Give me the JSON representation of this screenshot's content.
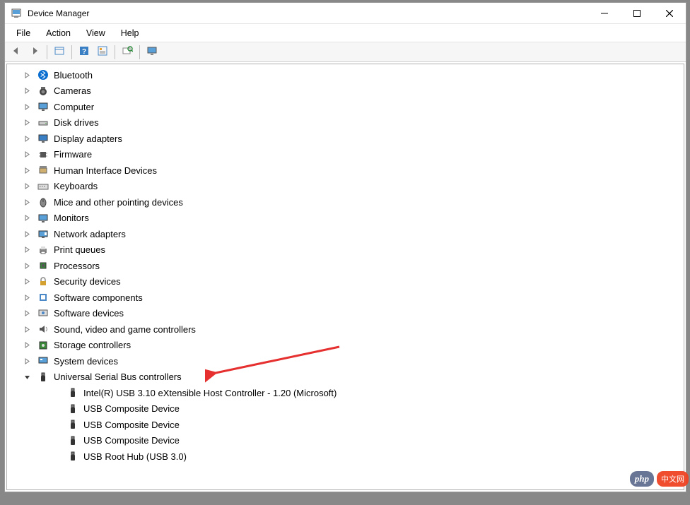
{
  "window": {
    "title": "Device Manager"
  },
  "menubar": {
    "items": [
      "File",
      "Action",
      "View",
      "Help"
    ]
  },
  "toolbar": {
    "buttons": [
      {
        "name": "back-icon"
      },
      {
        "name": "forward-icon"
      },
      {
        "sep": true
      },
      {
        "name": "show-hidden-icon"
      },
      {
        "sep": true
      },
      {
        "name": "help-icon"
      },
      {
        "name": "properties-icon"
      },
      {
        "sep": true
      },
      {
        "name": "scan-hardware-icon"
      },
      {
        "sep": true
      },
      {
        "name": "monitor-icon"
      }
    ]
  },
  "tree": {
    "categories": [
      {
        "label": "Bluetooth",
        "icon": "bluetooth",
        "expanded": false
      },
      {
        "label": "Cameras",
        "icon": "camera",
        "expanded": false
      },
      {
        "label": "Computer",
        "icon": "monitor",
        "expanded": false
      },
      {
        "label": "Disk drives",
        "icon": "disk",
        "expanded": false
      },
      {
        "label": "Display adapters",
        "icon": "display",
        "expanded": false
      },
      {
        "label": "Firmware",
        "icon": "chip",
        "expanded": false
      },
      {
        "label": "Human Interface Devices",
        "icon": "hid",
        "expanded": false
      },
      {
        "label": "Keyboards",
        "icon": "keyboard",
        "expanded": false
      },
      {
        "label": "Mice and other pointing devices",
        "icon": "mouse",
        "expanded": false
      },
      {
        "label": "Monitors",
        "icon": "monitor",
        "expanded": false
      },
      {
        "label": "Network adapters",
        "icon": "network",
        "expanded": false
      },
      {
        "label": "Print queues",
        "icon": "printer",
        "expanded": false
      },
      {
        "label": "Processors",
        "icon": "cpu",
        "expanded": false
      },
      {
        "label": "Security devices",
        "icon": "lock",
        "expanded": false
      },
      {
        "label": "Software components",
        "icon": "component",
        "expanded": false
      },
      {
        "label": "Software devices",
        "icon": "software",
        "expanded": false
      },
      {
        "label": "Sound, video and game controllers",
        "icon": "sound",
        "expanded": false
      },
      {
        "label": "Storage controllers",
        "icon": "storage",
        "expanded": false
      },
      {
        "label": "System devices",
        "icon": "system",
        "expanded": false
      },
      {
        "label": "Universal Serial Bus controllers",
        "icon": "usb",
        "expanded": true,
        "children": [
          {
            "label": "Intel(R) USB 3.10 eXtensible Host Controller - 1.20 (Microsoft)",
            "icon": "usb"
          },
          {
            "label": "USB Composite Device",
            "icon": "usb"
          },
          {
            "label": "USB Composite Device",
            "icon": "usb"
          },
          {
            "label": "USB Composite Device",
            "icon": "usb"
          },
          {
            "label": "USB Root Hub (USB 3.0)",
            "icon": "usb"
          }
        ]
      }
    ]
  },
  "watermark": {
    "left": "php",
    "right": "中文网"
  },
  "annotation": {
    "arrow_color": "#e63030"
  }
}
